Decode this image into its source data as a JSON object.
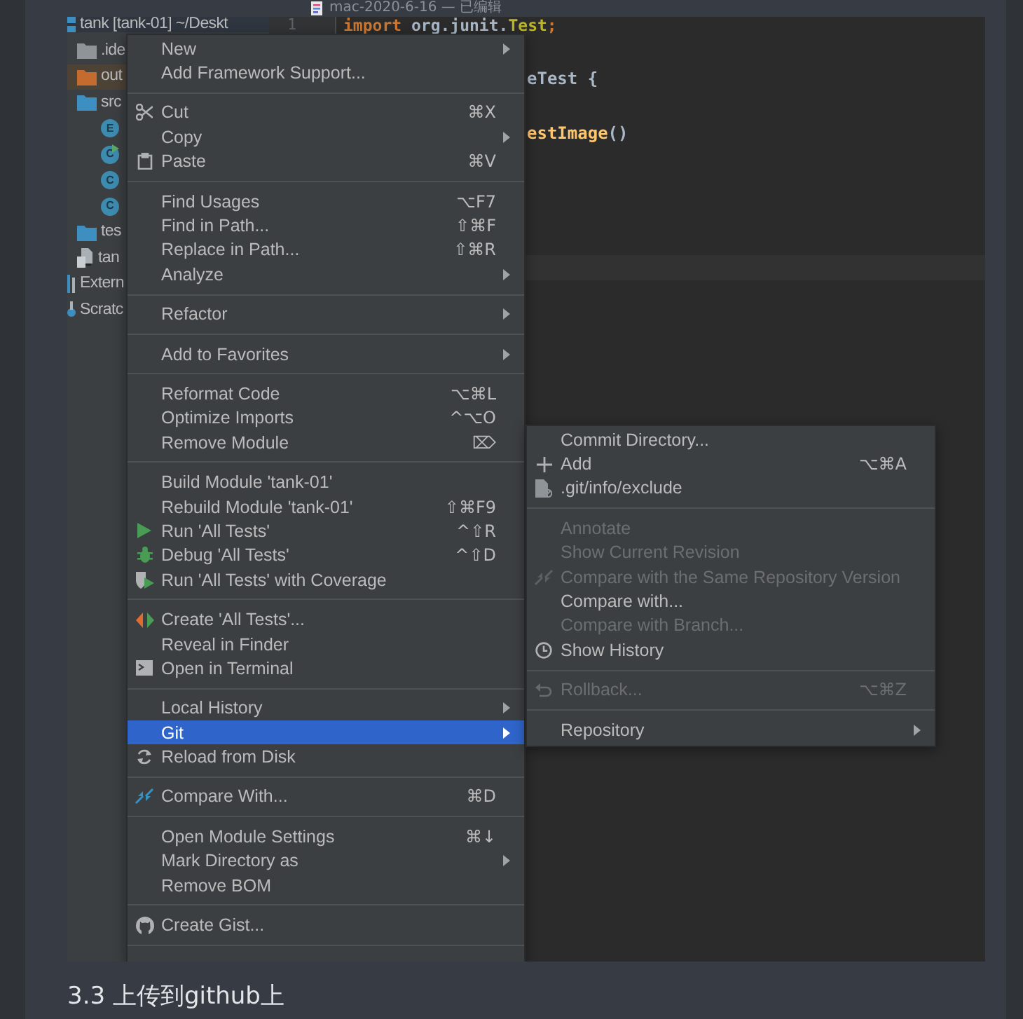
{
  "document_title": {
    "name": "mac-2020-6-16",
    "status": "— 已编辑"
  },
  "project_tree": [
    {
      "label": "tank [tank-01] ~/Deskt",
      "kind": "module",
      "selected": true,
      "children": [
        {
          "label": ".ide",
          "kind": "folder",
          "selected": false
        },
        {
          "label": "out",
          "kind": "excluded-folder",
          "selected": false
        },
        {
          "label": "src",
          "kind": "source-folder",
          "selected": false,
          "children": [
            {
              "kind": "class",
              "badge": "E",
              "runnable": false,
              "selected": false
            },
            {
              "kind": "class",
              "badge": "C",
              "runnable": true,
              "selected": false
            },
            {
              "kind": "class",
              "badge": "C",
              "runnable": false,
              "selected": false
            },
            {
              "kind": "class",
              "badge": "C",
              "runnable": false,
              "selected": false
            }
          ]
        },
        {
          "label": "tes",
          "kind": "source-folder",
          "selected": false
        },
        {
          "label": "tan",
          "kind": "file",
          "selected": false
        }
      ]
    },
    {
      "label": "Extern",
      "kind": "library",
      "selected": false
    },
    {
      "label": "Scratc",
      "kind": "scratch",
      "selected": false
    }
  ],
  "editor": {
    "gutter_number": "1",
    "lines": [
      {
        "obscured": false,
        "segments": [
          {
            "text": "import",
            "kind": "keyword"
          },
          {
            "text": " org.junit.",
            "kind": "plain"
          },
          {
            "text": "Test",
            "kind": "annotation"
          },
          {
            "text": ";",
            "kind": "keyword"
          }
        ]
      },
      {
        "obscured": true,
        "segments": [
          {
            "text": "eTest {",
            "kind": "plain"
          }
        ]
      },
      {
        "obscured": true,
        "segments": [
          {
            "text": "estImage",
            "kind": "method"
          },
          {
            "text": "()",
            "kind": "plain"
          }
        ]
      }
    ]
  },
  "context_menu": {
    "continues_below": true,
    "groups": [
      [
        {
          "label": "New",
          "submenu": true,
          "selected": false,
          "disabled": false
        },
        {
          "label": "Add Framework Support...",
          "submenu": false,
          "selected": false,
          "disabled": false
        }
      ],
      [
        {
          "label": "Cut",
          "shortcut": "⌘X",
          "kind": "scissors",
          "submenu": false,
          "selected": false,
          "disabled": false
        },
        {
          "label": "Copy",
          "submenu": true,
          "selected": false,
          "disabled": false
        },
        {
          "label": "Paste",
          "shortcut": "⌘V",
          "kind": "clipboard",
          "submenu": false,
          "selected": false,
          "disabled": false
        }
      ],
      [
        {
          "label": "Find Usages",
          "shortcut": "⌥F7",
          "submenu": false,
          "selected": false,
          "disabled": false
        },
        {
          "label": "Find in Path...",
          "shortcut": "⇧⌘F",
          "submenu": false,
          "selected": false,
          "disabled": false
        },
        {
          "label": "Replace in Path...",
          "shortcut": "⇧⌘R",
          "submenu": false,
          "selected": false,
          "disabled": false
        },
        {
          "label": "Analyze",
          "submenu": true,
          "selected": false,
          "disabled": false
        }
      ],
      [
        {
          "label": "Refactor",
          "submenu": true,
          "selected": false,
          "disabled": false
        }
      ],
      [
        {
          "label": "Add to Favorites",
          "submenu": true,
          "selected": false,
          "disabled": false
        }
      ],
      [
        {
          "label": "Reformat Code",
          "shortcut": "⌥⌘L",
          "submenu": false,
          "selected": false,
          "disabled": false
        },
        {
          "label": "Optimize Imports",
          "shortcut": "^⌥O",
          "submenu": false,
          "selected": false,
          "disabled": false
        },
        {
          "label": "Remove Module",
          "shortcut": "⌦",
          "submenu": false,
          "selected": false,
          "disabled": false
        }
      ],
      [
        {
          "label": "Build Module 'tank-01'",
          "submenu": false,
          "selected": false,
          "disabled": false
        },
        {
          "label": "Rebuild Module 'tank-01'",
          "shortcut": "⇧⌘F9",
          "submenu": false,
          "selected": false,
          "disabled": false
        },
        {
          "label": "Run 'All Tests'",
          "shortcut": "^⇧R",
          "kind": "run",
          "submenu": false,
          "selected": false,
          "disabled": false
        },
        {
          "label": "Debug 'All Tests'",
          "shortcut": "^⇧D",
          "kind": "debug",
          "submenu": false,
          "selected": false,
          "disabled": false
        },
        {
          "label": "Run 'All Tests' with Coverage",
          "kind": "coverage",
          "submenu": false,
          "selected": false,
          "disabled": false
        }
      ],
      [
        {
          "label": "Create 'All Tests'...",
          "kind": "create-test",
          "submenu": false,
          "selected": false,
          "disabled": false
        },
        {
          "label": "Reveal in Finder",
          "submenu": false,
          "selected": false,
          "disabled": false
        },
        {
          "label": "Open in Terminal",
          "kind": "terminal",
          "submenu": false,
          "selected": false,
          "disabled": false
        }
      ],
      [
        {
          "label": "Local History",
          "submenu": true,
          "selected": false,
          "disabled": false
        },
        {
          "label": "Git",
          "submenu": true,
          "selected": true,
          "disabled": false
        },
        {
          "label": "Reload from Disk",
          "kind": "reload",
          "submenu": false,
          "selected": false,
          "disabled": false
        }
      ],
      [
        {
          "label": "Compare With...",
          "shortcut": "⌘D",
          "kind": "compare",
          "submenu": false,
          "selected": false,
          "disabled": false
        }
      ],
      [
        {
          "label": "Open Module Settings",
          "shortcut": "⌘↓",
          "submenu": false,
          "selected": false,
          "disabled": false
        },
        {
          "label": "Mark Directory as",
          "submenu": true,
          "selected": false,
          "disabled": false
        },
        {
          "label": "Remove BOM",
          "submenu": false,
          "selected": false,
          "disabled": false
        }
      ],
      [
        {
          "label": "Create Gist...",
          "kind": "github",
          "submenu": false,
          "selected": false,
          "disabled": false
        }
      ]
    ]
  },
  "git_submenu": {
    "continues_below": false,
    "groups": [
      [
        {
          "label": "Commit Directory...",
          "submenu": false,
          "selected": false,
          "disabled": false
        },
        {
          "label": "Add",
          "shortcut": "⌥⌘A",
          "kind": "plus",
          "submenu": false,
          "selected": false,
          "disabled": false
        },
        {
          "label": ".git/info/exclude",
          "kind": "exclude",
          "submenu": false,
          "selected": false,
          "disabled": false
        }
      ],
      [
        {
          "label": "Annotate",
          "submenu": false,
          "selected": false,
          "disabled": true
        },
        {
          "label": "Show Current Revision",
          "submenu": false,
          "selected": false,
          "disabled": true
        },
        {
          "label": "Compare with the Same Repository Version",
          "kind": "compare",
          "submenu": false,
          "selected": false,
          "disabled": true
        },
        {
          "label": "Compare with...",
          "submenu": false,
          "selected": false,
          "disabled": false
        },
        {
          "label": "Compare with Branch...",
          "submenu": false,
          "selected": false,
          "disabled": true
        },
        {
          "label": "Show History",
          "kind": "clock",
          "submenu": false,
          "selected": false,
          "disabled": false
        }
      ],
      [
        {
          "label": "Rollback...",
          "shortcut": "⌥⌘Z",
          "kind": "rollback",
          "submenu": false,
          "selected": false,
          "disabled": true
        }
      ],
      [
        {
          "label": "Repository",
          "submenu": true,
          "selected": false,
          "disabled": false
        }
      ]
    ]
  },
  "section_heading": "3.3 上传到github上"
}
